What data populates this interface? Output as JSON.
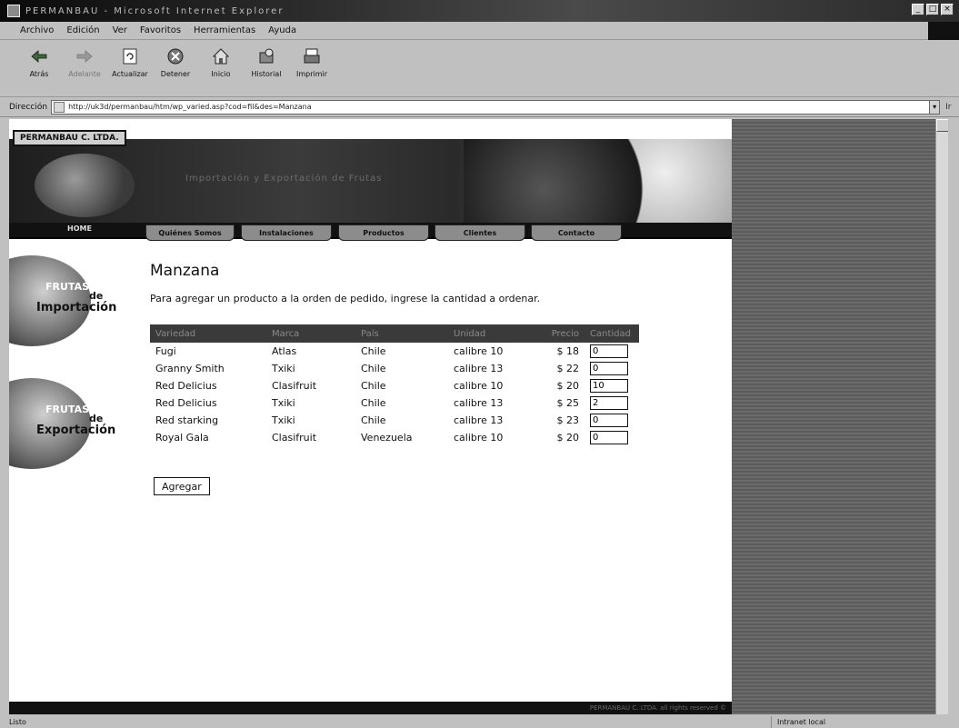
{
  "window": {
    "title": "PERMANBAU - Microsoft Internet Explorer",
    "controls": [
      "_",
      "□",
      "×"
    ]
  },
  "menubar": [
    "Archivo",
    "Edición",
    "Ver",
    "Favoritos",
    "Herramientas",
    "Ayuda"
  ],
  "toolbar": [
    {
      "label": "Atrás",
      "icon": "back-arrow-icon"
    },
    {
      "label": "Adelante",
      "icon": "forward-arrow-icon"
    },
    {
      "label": "Actualizar",
      "icon": "refresh-icon"
    },
    {
      "label": "Detener",
      "icon": "stop-icon"
    },
    {
      "label": "Inicio",
      "icon": "home-icon"
    },
    {
      "label": "Historial",
      "icon": "history-icon"
    },
    {
      "label": "Imprimir",
      "icon": "print-icon"
    }
  ],
  "address": {
    "label": "Dirección",
    "url": "http://uk3d/permanbau/htm/wp_varied.asp?cod=fil&des=Manzana",
    "go": "Ir"
  },
  "site": {
    "company": "PERMANBAU C. LTDA.",
    "tagline": "Importación y Exportación de Frutas",
    "nav": [
      "HOME",
      "Quiénes Somos",
      "Instalaciones",
      "Productos",
      "Clientes",
      "Contacto"
    ],
    "side": [
      {
        "line1": "FRUTAS",
        "line2": "de",
        "line3": "Importación"
      },
      {
        "line1": "FRUTAS",
        "line2": "de",
        "line3": "Exportación"
      }
    ],
    "footer": "PERMANBAU C. LTDA. all rights reserved ©"
  },
  "page": {
    "title": "Manzana",
    "instructions": "Para agregar un producto a la orden de pedido, ingrese la cantidad a ordenar.",
    "columns": [
      "Variedad",
      "Marca",
      "País",
      "Unidad",
      "Precio",
      "Cantidad"
    ],
    "rows": [
      {
        "variedad": "Fugi",
        "marca": "Atlas",
        "pais": "Chile",
        "unidad": "calibre 10",
        "precio": "$ 18",
        "cantidad": "0"
      },
      {
        "variedad": "Granny Smith",
        "marca": "Txiki",
        "pais": "Chile",
        "unidad": "calibre 13",
        "precio": "$ 22",
        "cantidad": "0"
      },
      {
        "variedad": "Red Delicius",
        "marca": "Clasifruit",
        "pais": "Chile",
        "unidad": "calibre 10",
        "precio": "$ 20",
        "cantidad": "10"
      },
      {
        "variedad": "Red Delicius",
        "marca": "Txiki",
        "pais": "Chile",
        "unidad": "calibre 13",
        "precio": "$ 25",
        "cantidad": "2"
      },
      {
        "variedad": "Red starking",
        "marca": "Txiki",
        "pais": "Chile",
        "unidad": "calibre 13",
        "precio": "$ 23",
        "cantidad": "0"
      },
      {
        "variedad": "Royal Gala",
        "marca": "Clasifruit",
        "pais": "Venezuela",
        "unidad": "calibre 10",
        "precio": "$ 20",
        "cantidad": "0"
      }
    ],
    "button": "Agregar"
  },
  "status": {
    "left": "Listo",
    "zone": "Intranet local"
  }
}
